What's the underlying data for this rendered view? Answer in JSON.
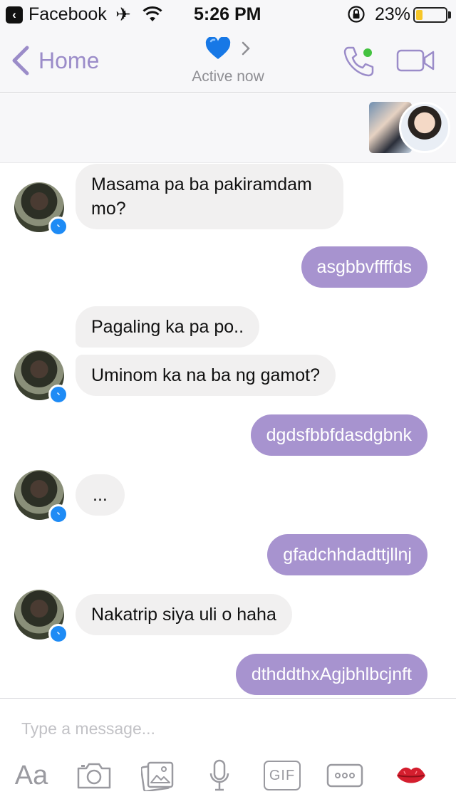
{
  "status_bar": {
    "back_app": "Facebook",
    "time": "5:26 PM",
    "battery_percent": "23%",
    "battery_level": 0.23,
    "icons": [
      "back-arrow-icon",
      "airplane-icon",
      "wifi-icon",
      "rotation-lock-icon",
      "battery-icon"
    ]
  },
  "nav": {
    "back_label": "Home",
    "title_emoji": "💙",
    "subtitle": "Active now",
    "accent_color": "#9b8cc9",
    "active_dot_color": "#44c240",
    "icons": [
      "chevron-left-icon",
      "blue-heart-icon",
      "chevron-right-icon",
      "phone-call-icon",
      "video-call-icon"
    ]
  },
  "messages": [
    {
      "direction": "incoming",
      "text": "Masama pa ba pakiramdam mo?",
      "line1": "Masama pa ba pakiramdam",
      "line2": "mo?"
    },
    {
      "direction": "outgoing",
      "text": "asgbbvffffds"
    },
    {
      "direction": "incoming",
      "text": "Pagaling ka pa po.."
    },
    {
      "direction": "incoming",
      "text": "Uminom ka na ba ng gamot?"
    },
    {
      "direction": "outgoing",
      "text": "dgdsfbbfdasdgbnk"
    },
    {
      "direction": "incoming",
      "text": "..."
    },
    {
      "direction": "outgoing",
      "text": "gfadchhdadttjllnj"
    },
    {
      "direction": "incoming",
      "text": "Nakatrip siya uli o haha"
    },
    {
      "direction": "outgoing",
      "text": "dthddthxAgjbhlbcjnft"
    }
  ],
  "colors": {
    "outgoing_bubble": "#a793cf",
    "incoming_bubble": "#f1f0f0",
    "messenger_badge": "#1e8bf5"
  },
  "composer": {
    "placeholder": "Type a message...",
    "aa_label": "Aa",
    "gif_label": "GIF",
    "icons": [
      "text-style-icon",
      "camera-icon",
      "gallery-icon",
      "microphone-icon",
      "gif-icon",
      "more-icon",
      "kiss-lips-icon"
    ]
  }
}
